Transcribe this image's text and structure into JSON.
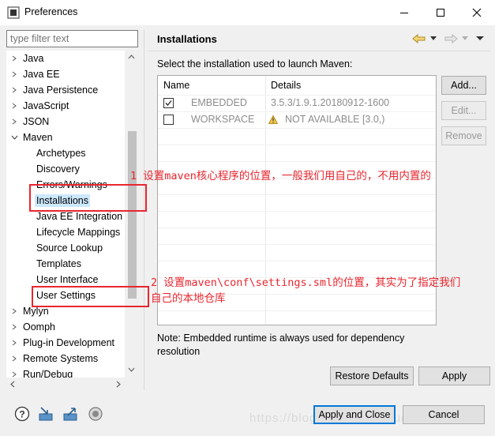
{
  "window": {
    "title": "Preferences"
  },
  "filter": {
    "placeholder": "type filter text"
  },
  "tree": {
    "items": [
      {
        "label": "Java",
        "expanded": false
      },
      {
        "label": "Java EE",
        "expanded": false
      },
      {
        "label": "Java Persistence",
        "expanded": false
      },
      {
        "label": "JavaScript",
        "expanded": false
      },
      {
        "label": "JSON",
        "expanded": false
      },
      {
        "label": "Maven",
        "expanded": true
      },
      {
        "label": "Archetypes"
      },
      {
        "label": "Discovery"
      },
      {
        "label": "Errors/Warnings"
      },
      {
        "label": "Installations",
        "selected": true
      },
      {
        "label": "Java EE Integration"
      },
      {
        "label": "Lifecycle Mappings"
      },
      {
        "label": "Source Lookup"
      },
      {
        "label": "Templates"
      },
      {
        "label": "User Interface"
      },
      {
        "label": "User Settings"
      },
      {
        "label": "Mylyn",
        "expanded": false
      },
      {
        "label": "Oomph",
        "expanded": false
      },
      {
        "label": "Plug-in Development",
        "expanded": false
      },
      {
        "label": "Remote Systems",
        "expanded": false
      },
      {
        "label": "Run/Debug",
        "expanded": false
      }
    ]
  },
  "page": {
    "title": "Installations",
    "description": "Select the installation used to launch Maven:",
    "table": {
      "columns": [
        "Name",
        "Details"
      ],
      "rows": [
        {
          "checked": true,
          "name": "EMBEDDED",
          "details": "3.5.3/1.9.1.20180912-1600",
          "warning": false
        },
        {
          "checked": false,
          "name": "WORKSPACE",
          "details": "NOT AVAILABLE [3.0,)",
          "warning": true
        }
      ]
    },
    "buttons": {
      "add": "Add...",
      "edit": "Edit...",
      "remove": "Remove"
    },
    "note": "Note: Embedded runtime is always used for dependency resolution",
    "restore_defaults": "Restore Defaults",
    "apply": "Apply"
  },
  "footer": {
    "apply_and_close": "Apply and Close",
    "cancel": "Cancel"
  },
  "annotations": {
    "first": "1 设置maven核心程序的位置，一般我们用自己的，不用内置的",
    "second_line1": "2 设置maven\\conf\\settings.sml的位置，其实为了指定我们",
    "second_line2": "自己的本地仓库"
  },
  "watermark": "https://blog.csdn.net/liuludiyu",
  "colors": {
    "annotation_red": "#e8262e",
    "selection": "#cce8ff",
    "focus_blue": "#0078d7"
  }
}
